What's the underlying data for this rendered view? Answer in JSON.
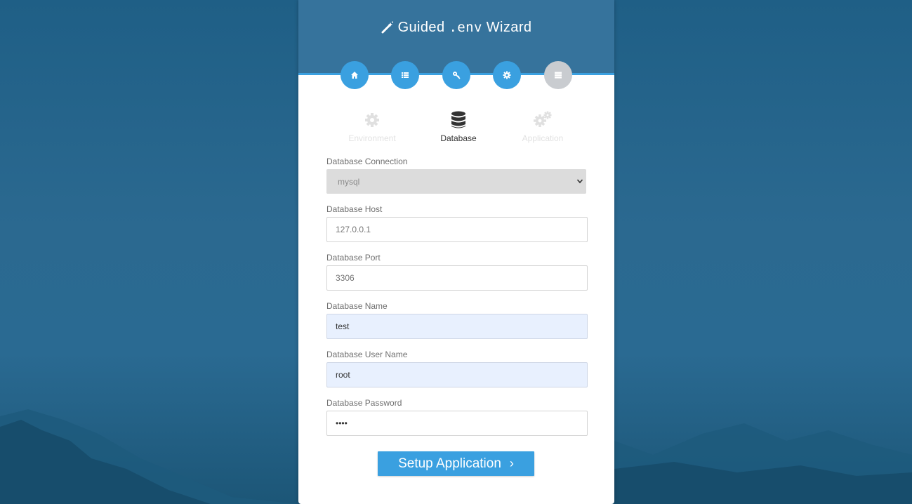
{
  "header": {
    "title_prefix": "Guided",
    "title_mono": ".env",
    "title_suffix": "Wizard"
  },
  "steps": [
    {
      "icon": "home-icon",
      "active": true
    },
    {
      "icon": "list-icon",
      "active": true
    },
    {
      "icon": "key-icon",
      "active": true
    },
    {
      "icon": "gear-icon",
      "active": true
    },
    {
      "icon": "server-icon",
      "active": false
    }
  ],
  "tabs": {
    "environment": "Environment",
    "database": "Database",
    "application": "Application"
  },
  "form": {
    "connection": {
      "label": "Database Connection",
      "value": "mysql"
    },
    "host": {
      "label": "Database Host",
      "value": "127.0.0.1"
    },
    "port": {
      "label": "Database Port",
      "value": "3306"
    },
    "name": {
      "label": "Database Name",
      "value": "test"
    },
    "username": {
      "label": "Database User Name",
      "value": "root"
    },
    "password": {
      "label": "Database Password",
      "value": "••••"
    }
  },
  "button": {
    "label": "Setup Application",
    "arrow": "›"
  },
  "colors": {
    "accent": "#3aa0e0",
    "header": "#36739c",
    "inactive": "#c9ccd0",
    "autofill": "#e8f0fe"
  }
}
